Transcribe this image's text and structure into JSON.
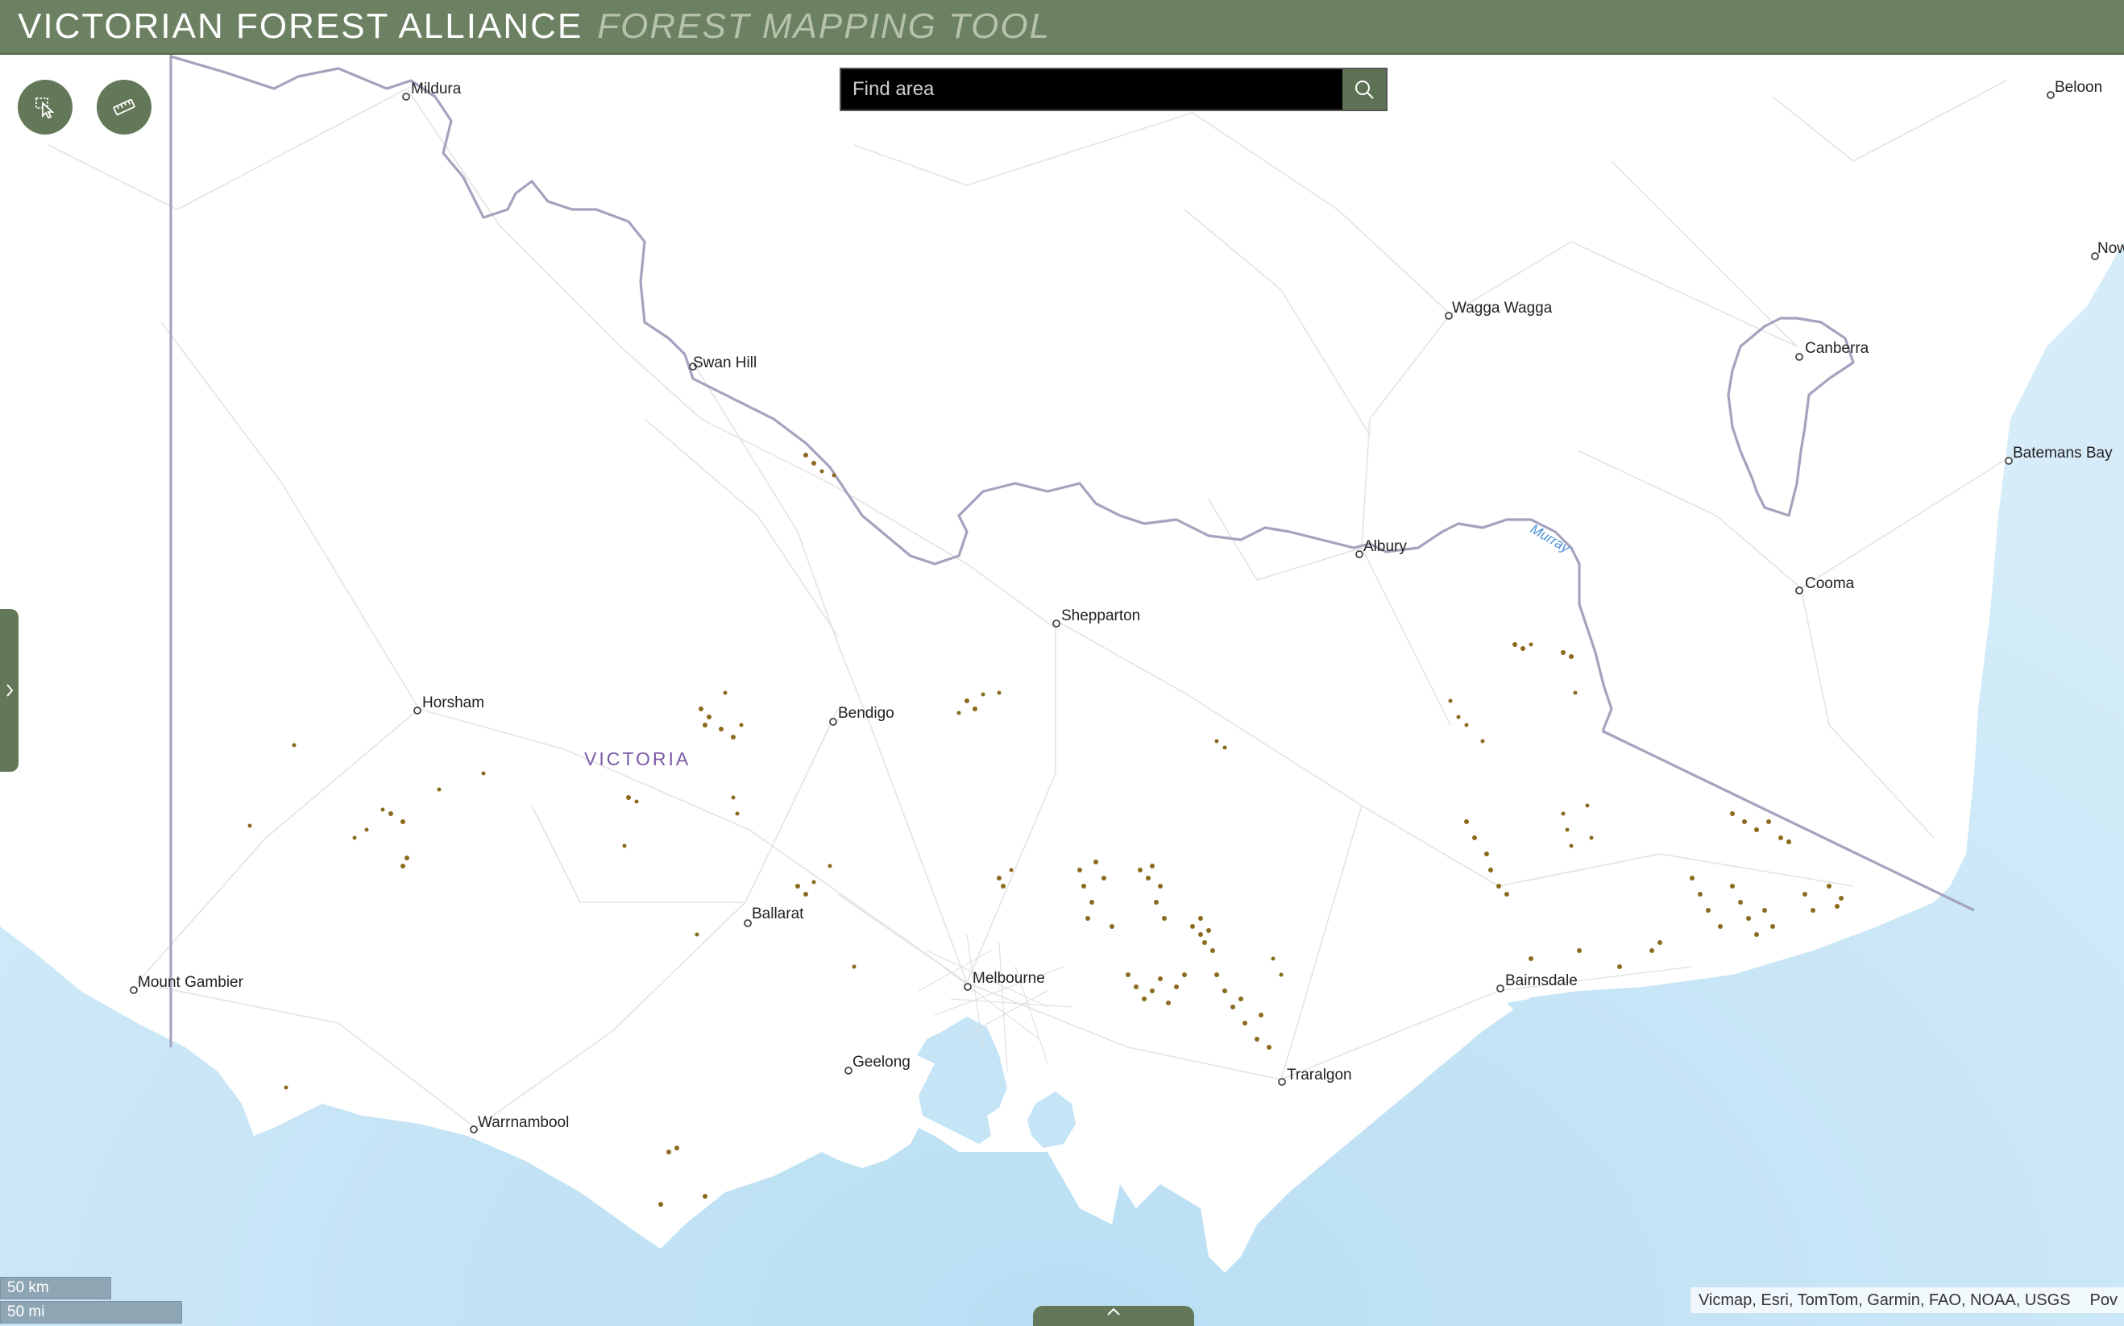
{
  "header": {
    "title": "VICTORIAN FOREST ALLIANCE",
    "subtitle": "FOREST MAPPING TOOL"
  },
  "tools": [
    {
      "name": "select-tool-button",
      "icon": "select-area-icon"
    },
    {
      "name": "measure-tool-button",
      "icon": "ruler-icon"
    }
  ],
  "search": {
    "placeholder": "Find area",
    "value": ""
  },
  "map": {
    "state_label": "VICTORIA",
    "river_label": "Murray",
    "places": [
      "Mildura",
      "Swan Hill",
      "Wagga Wagga",
      "Canberra",
      "Batemans Bay",
      "Albury",
      "Cooma",
      "Shepparton",
      "Horsham",
      "Bendigo",
      "Ballarat",
      "Melbourne",
      "Mount Gambier",
      "Geelong",
      "Bairnsdale",
      "Traralgon",
      "Warrnambool",
      "Beloon",
      "Now"
    ],
    "colors": {
      "sea": "#d8eefa",
      "land": "#ffffff",
      "border": "#a3a3bd",
      "forest": "#8b6a1e",
      "header": "#6c8062"
    }
  },
  "scale": {
    "km": "50 km",
    "mi": "50 mi"
  },
  "attribution": {
    "text": "Vicmap, Esri, TomTom, Garmin, FAO, NOAA, USGS",
    "powered": "Pov"
  }
}
